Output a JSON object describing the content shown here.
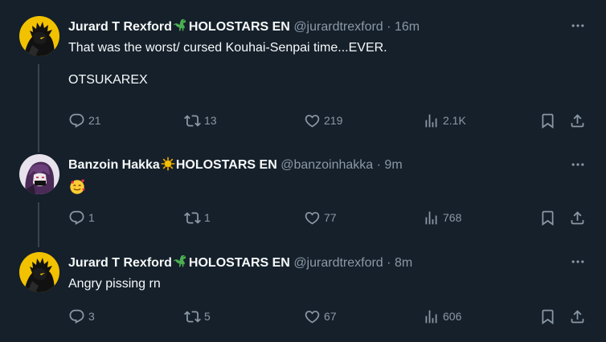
{
  "tweets": [
    {
      "name": "Jurard T Rexford",
      "badge": "HOLOSTARS EN",
      "handle": "@jurardtrexford",
      "time": "16m",
      "text": "That was the worst/ cursed Kouhai-Senpai time...EVER.\n\nOTSUKAREX",
      "replies": "21",
      "retweets": "13",
      "likes": "219",
      "views": "2.1K",
      "name_emoji": "dinosaur-emoji"
    },
    {
      "name": "Banzoin Hakka",
      "badge": "HOLOSTARS EN",
      "handle": "@banzoinhakka",
      "time": "9m",
      "text": "",
      "replies": "1",
      "retweets": "1",
      "likes": "77",
      "views": "768",
      "name_emoji": "sun-emoji",
      "body_emoji": "smiling-face-with-hearts-emoji"
    },
    {
      "name": "Jurard T Rexford",
      "badge": "HOLOSTARS EN",
      "handle": "@jurardtrexford",
      "time": "8m",
      "text": "Angry pissing rn",
      "replies": "3",
      "retweets": "5",
      "likes": "67",
      "views": "606",
      "name_emoji": "dinosaur-emoji"
    }
  ],
  "separator": "·",
  "colors": {
    "background": "#15202b",
    "text": "#f7f9f9",
    "muted": "#8b98a5",
    "divider": "#38444d",
    "accent_yellow": "#f2c200",
    "dino_green": "#4caf50"
  }
}
